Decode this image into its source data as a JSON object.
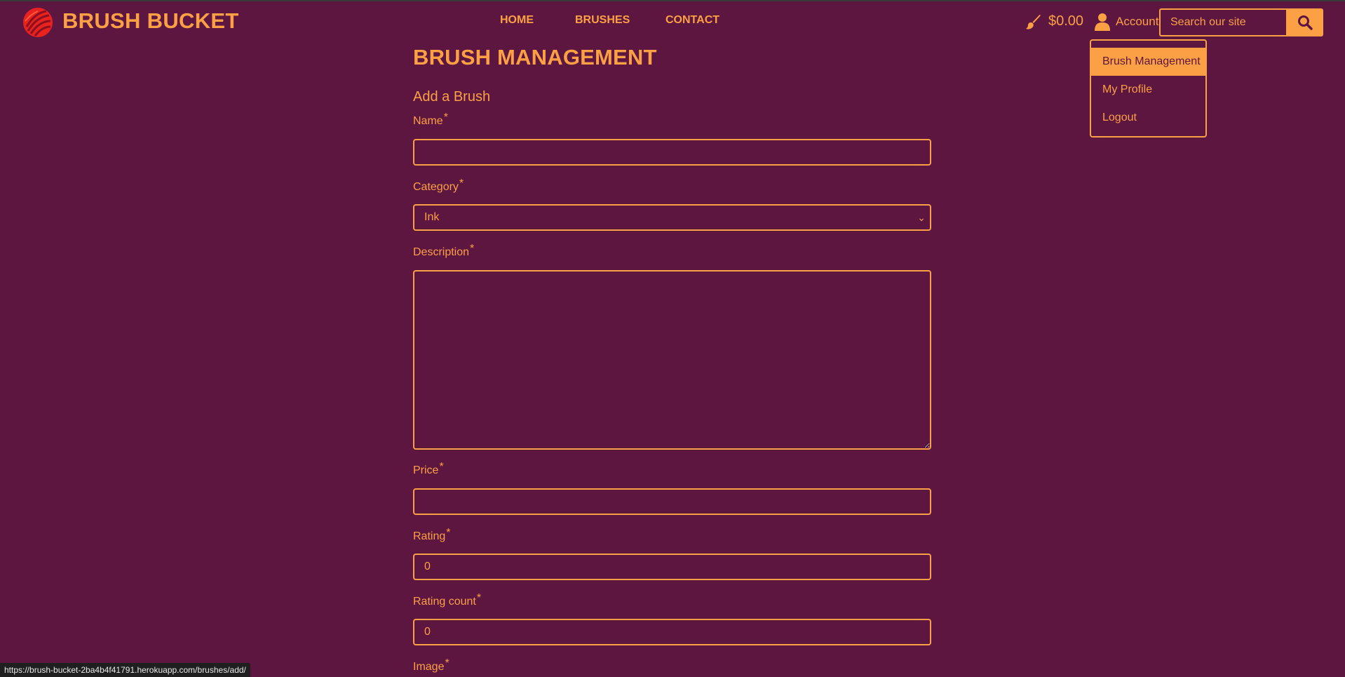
{
  "header": {
    "brand": "BRUSH BUCKET",
    "nav": [
      "HOME",
      "BRUSHES",
      "CONTACT"
    ],
    "cart_total": "$0.00",
    "account_label": "Account",
    "search_placeholder": "Search our site",
    "icons": {
      "logo": "brush-bucket-logo",
      "cart": "paintbrush-icon",
      "account": "user-icon",
      "search": "search-icon"
    }
  },
  "account_menu": {
    "items": [
      "Brush Management",
      "My Profile",
      "Logout"
    ],
    "active": "Brush Management"
  },
  "page": {
    "title": "BRUSH MANAGEMENT",
    "subtitle": "Add a Brush",
    "required_marker": "*",
    "fields": {
      "name": {
        "label": "Name",
        "value": ""
      },
      "category": {
        "label": "Category",
        "value": "Ink"
      },
      "description": {
        "label": "Description",
        "value": ""
      },
      "price": {
        "label": "Price",
        "value": ""
      },
      "rating": {
        "label": "Rating",
        "value": "0"
      },
      "rating_count": {
        "label": "Rating count",
        "value": "0"
      },
      "image": {
        "label": "Image"
      }
    }
  },
  "status_bar": {
    "url": "https://brush-bucket-2ba4b4f41791.herokuapp.com/brushes/add/"
  },
  "colors": {
    "background": "#5d1640",
    "accent": "#fba045"
  }
}
